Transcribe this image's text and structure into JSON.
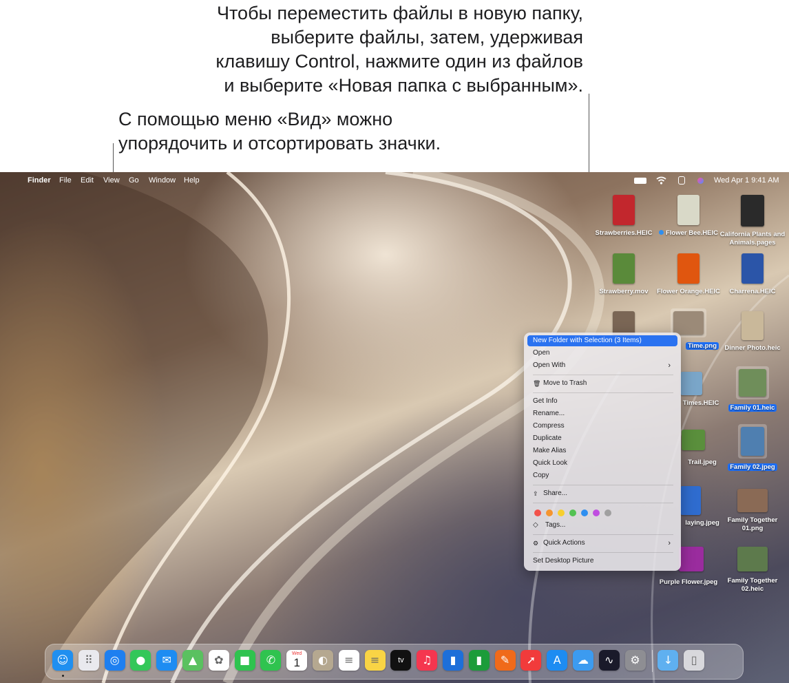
{
  "callouts": {
    "top": [
      "Чтобы переместить файлы в новую папку,",
      "выберите файлы, затем, удерживая",
      "клавишу Control, нажмите один из файлов",
      "и выберите «Новая папка с выбранным»."
    ],
    "left": [
      "С помощью меню «Вид» можно",
      "упорядочить и отсортировать значки."
    ]
  },
  "menubar": {
    "app": "Finder",
    "items": [
      "File",
      "Edit",
      "View",
      "Go",
      "Window",
      "Help"
    ],
    "datetime": "Wed Apr 1  9:41 AM",
    "icons": [
      "apple-icon",
      "battery-icon",
      "wifi-icon",
      "control-center-icon",
      "siri-icon"
    ]
  },
  "desktop_files": [
    {
      "label": "Strawberries.HEIC",
      "color": "#c2272d"
    },
    {
      "label": "Flower Bee.HEIC",
      "color": "#d9d9c8"
    },
    {
      "label": "California Plants and Animals.pages",
      "color": "#2a2a2a"
    },
    {
      "label": "Strawberry.mov",
      "color": "#5a8a3a"
    },
    {
      "label": "Flower Orange.HEIC",
      "color": "#e0560f"
    },
    {
      "label": "Charrena.HEIC",
      "color": "#2b55a8"
    },
    {
      "label": "Time.png",
      "color": "#9b8a78"
    },
    {
      "label": "Dinner Photo.heic",
      "color": "#c9b89a"
    },
    {
      "label": "Times.HEIC",
      "color": "#7aa6c9"
    },
    {
      "label": "Family 01.heic",
      "color": "#6f8e5a"
    },
    {
      "label": "Trail.jpeg",
      "color": "#5a8f3c"
    },
    {
      "label": "Family 02.jpeg",
      "color": "#4f7fb0"
    },
    {
      "label": "laying.jpeg",
      "color": "#2f6ccf"
    },
    {
      "label": "Family Together 01.png",
      "color": "#8a6a55"
    },
    {
      "label": "Purple Flower.jpeg",
      "color": "#9a2c9e"
    },
    {
      "label": "Family Together 02.heic",
      "color": "#5d7a4c"
    }
  ],
  "context_menu": {
    "new_folder": "New Folder with Selection (3 Items)",
    "open": "Open",
    "open_with": "Open With",
    "trash": "Move to Trash",
    "get_info": "Get Info",
    "rename": "Rename...",
    "compress": "Compress",
    "duplicate": "Duplicate",
    "make_alias": "Make Alias",
    "quick_look": "Quick Look",
    "copy": "Copy",
    "share": "Share...",
    "tags": "Tags...",
    "quick_actions": "Quick Actions",
    "set_desktop": "Set Desktop Picture",
    "tag_colors": [
      "#f2524a",
      "#f5952f",
      "#f7cf2e",
      "#53c253",
      "#2f8ff0",
      "#c04ee0",
      "#a0a0a0"
    ]
  },
  "dock": {
    "calendar_month": "Wed",
    "calendar_day": "1",
    "apps": [
      {
        "name": "finder-icon",
        "color": "#1f8ff0",
        "glyph": "☺"
      },
      {
        "name": "launchpad-icon",
        "color": "#e9e9ee",
        "glyph": "⠿"
      },
      {
        "name": "safari-icon",
        "color": "#1e7ff0",
        "glyph": "◎"
      },
      {
        "name": "messages-icon",
        "color": "#33c759",
        "glyph": "●"
      },
      {
        "name": "mail-icon",
        "color": "#1d8cf2",
        "glyph": "✉"
      },
      {
        "name": "maps-icon",
        "color": "#5ac160",
        "glyph": "▲"
      },
      {
        "name": "photos-icon",
        "color": "#ffffff",
        "glyph": "✿"
      },
      {
        "name": "facetime-icon",
        "color": "#2fc34f",
        "glyph": "■"
      },
      {
        "name": "phone-icon",
        "color": "#2fc34f",
        "glyph": "✆"
      },
      {
        "name": "calendar-icon",
        "color": "#ffffff",
        "glyph": ""
      },
      {
        "name": "contacts-icon",
        "color": "#b5a890",
        "glyph": "◐"
      },
      {
        "name": "reminders-icon",
        "color": "#ffffff",
        "glyph": "≡"
      },
      {
        "name": "notes-icon",
        "color": "#f9d445",
        "glyph": "≡"
      },
      {
        "name": "tv-icon",
        "color": "#111111",
        "glyph": "tv"
      },
      {
        "name": "music-icon",
        "color": "#f5364f",
        "glyph": "♫"
      },
      {
        "name": "keynote-icon",
        "color": "#1e6fd9",
        "glyph": "▮"
      },
      {
        "name": "numbers-icon",
        "color": "#1c9c3a",
        "glyph": "▮"
      },
      {
        "name": "pages-icon",
        "color": "#f06a1a",
        "glyph": "✎"
      },
      {
        "name": "rocket-icon",
        "color": "#f13b3b",
        "glyph": "➚"
      },
      {
        "name": "app-store-icon",
        "color": "#1d8cf2",
        "glyph": "A"
      },
      {
        "name": "weather-icon",
        "color": "#3c9bf0",
        "glyph": "☁"
      },
      {
        "name": "stocks-icon",
        "color": "#1a1a2a",
        "glyph": "∿"
      },
      {
        "name": "system-settings-icon",
        "color": "#8e8e93",
        "glyph": "⚙"
      },
      {
        "name": "downloads-folder-icon",
        "color": "#5fb0f0",
        "glyph": "↓"
      },
      {
        "name": "trash-icon",
        "color": "#d8d8dc",
        "glyph": "▯"
      }
    ]
  }
}
